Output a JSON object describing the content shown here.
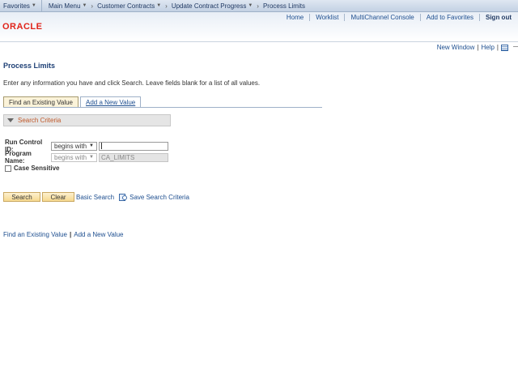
{
  "topnav": {
    "favorites": "Favorites",
    "main_menu": "Main Menu",
    "breadcrumb": [
      "Customer Contracts",
      "Update Contract Progress",
      "Process Limits"
    ]
  },
  "header": {
    "logo": "ORACLE",
    "links": [
      "Home",
      "Worklist",
      "MultiChannel Console",
      "Add to Favorites"
    ],
    "sign_out": "Sign out"
  },
  "utility": {
    "new_window": "New Window",
    "help": "Help",
    "separator": "|"
  },
  "page": {
    "title": "Process Limits",
    "instructions": "Enter any information you have and click Search. Leave fields blank for a list of all values."
  },
  "tabs": [
    {
      "label": "Find an Existing Value",
      "active": true
    },
    {
      "label": "Add a New Value",
      "active": false
    }
  ],
  "criteria": {
    "header": "Search Criteria",
    "run_control": {
      "label": "Run Control ID:",
      "operator": "begins with",
      "value": ""
    },
    "program_name": {
      "label": "Program Name:",
      "operator": "begins with",
      "value": "CA_LIMITS"
    },
    "case_sensitive": "Case Sensitive"
  },
  "actions": {
    "search": "Search",
    "clear": "Clear",
    "basic_search": "Basic Search",
    "save_search": "Save Search Criteria"
  },
  "bottom_links": {
    "find": "Find an Existing Value",
    "add": "Add a New Value",
    "separator": "|"
  },
  "colors": {
    "link": "#1d4e8f",
    "title": "#1d3f75",
    "brand": "#e0241b",
    "criteria_label": "#c0592a"
  }
}
